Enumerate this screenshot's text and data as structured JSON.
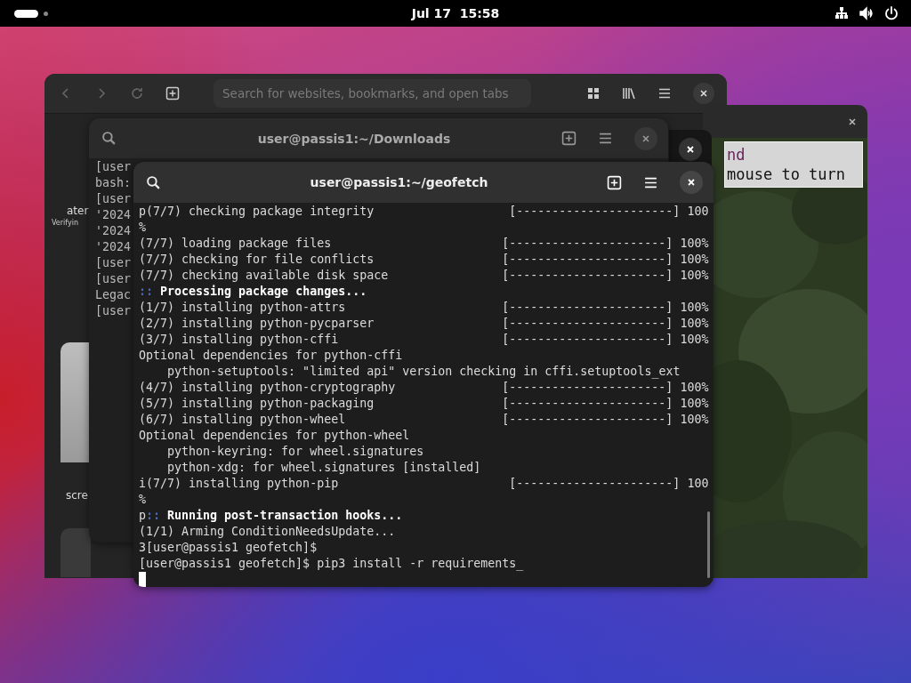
{
  "top_bar": {
    "clock": "Jul 17  15:58"
  },
  "browser": {
    "search": {
      "placeholder": "Search for websites, bookmarks, and open tabs"
    },
    "page_texts": [
      {
        "text": "ater",
        "kind": "title"
      },
      {
        "text": "Verifyin",
        "kind": "caption"
      },
      {
        "text": "scre",
        "kind": "label"
      }
    ]
  },
  "game_window": {
    "hint_lines": [
      {
        "text": "nd",
        "kind": "highlight"
      },
      {
        "text": "mouse to turn",
        "kind": "plain"
      }
    ]
  },
  "downloads_terminal": {
    "title": "user@passis1:~/Downloads",
    "lines": [
      "[user",
      "bash:",
      "[user",
      "'2024",
      "'2024",
      "'2024",
      "[user",
      "[user",
      "Legac",
      "[user"
    ]
  },
  "terminal": {
    "title": "user@passis1:~/geofetch",
    "lines": [
      {
        "kind": "progress",
        "text": "p(7/7) checking package integrity",
        "bar": "[----------------------]",
        "percent": "100"
      },
      {
        "kind": "plain",
        "text": "%"
      },
      {
        "kind": "progress",
        "text": "(7/7) loading package files",
        "bar": "[----------------------]",
        "percent": "100%"
      },
      {
        "kind": "progress",
        "text": "(7/7) checking for file conflicts",
        "bar": "[----------------------]",
        "percent": "100%"
      },
      {
        "kind": "progress",
        "text": "(7/7) checking available disk space",
        "bar": "[----------------------]",
        "percent": "100%"
      },
      {
        "kind": "section",
        "marker": "::",
        "text": "Processing package changes..."
      },
      {
        "kind": "progress",
        "text": "(1/7) installing python-attrs",
        "bar": "[----------------------]",
        "percent": "100%"
      },
      {
        "kind": "progress",
        "text": "(2/7) installing python-pycparser",
        "bar": "[----------------------]",
        "percent": "100%"
      },
      {
        "kind": "progress",
        "text": "(3/7) installing python-cffi",
        "bar": "[----------------------]",
        "percent": "100%"
      },
      {
        "kind": "plain",
        "text": "Optional dependencies for python-cffi"
      },
      {
        "kind": "plain",
        "text": "    python-setuptools: \"limited api\" version checking in cffi.setuptools_ext"
      },
      {
        "kind": "progress",
        "text": "(4/7) installing python-cryptography",
        "bar": "[----------------------]",
        "percent": "100%"
      },
      {
        "kind": "progress",
        "text": "(5/7) installing python-packaging",
        "bar": "[----------------------]",
        "percent": "100%"
      },
      {
        "kind": "progress",
        "text": "(6/7) installing python-wheel",
        "bar": "[----------------------]",
        "percent": "100%"
      },
      {
        "kind": "plain",
        "text": "Optional dependencies for python-wheel"
      },
      {
        "kind": "plain",
        "text": "    python-keyring: for wheel.signatures"
      },
      {
        "kind": "plain",
        "text": "    python-xdg: for wheel.signatures [installed]"
      },
      {
        "kind": "progress",
        "text": "i(7/7) installing python-pip",
        "bar": "[----------------------]",
        "percent": "100"
      },
      {
        "kind": "plain",
        "text": "%"
      },
      {
        "kind": "section",
        "lead": "p",
        "marker": "::",
        "text": "Running post-transaction hooks..."
      },
      {
        "kind": "plain",
        "text": "(1/1) Arming ConditionNeedsUpdate..."
      },
      {
        "kind": "plain",
        "text": "3[user@passis1 geofetch]$"
      },
      {
        "kind": "plain",
        "text": "[user@passis1 geofetch]$ pip3 install -r requirements_"
      }
    ]
  }
}
